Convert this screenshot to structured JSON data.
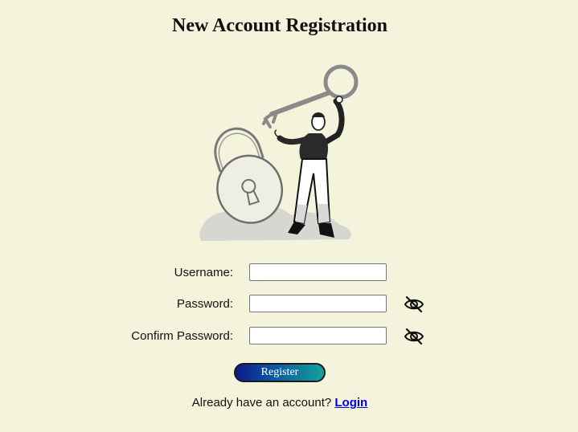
{
  "page": {
    "title": "New Account Registration"
  },
  "illustration": {
    "icon": "person-holding-key-with-padlock-illustration"
  },
  "form": {
    "username_label": "Username:",
    "username_value": "",
    "password_label": "Password:",
    "password_value": "",
    "confirm_label": "Confirm Password:",
    "confirm_value": "",
    "toggle_icon": "eye-slash-icon",
    "register_label": "Register"
  },
  "footer": {
    "prompt": "Already have an account?",
    "login_link": "Login"
  },
  "colors": {
    "background": "#f4f4dc",
    "button_gradient_start": "#0a1a8c",
    "button_gradient_end": "#12a39a",
    "link": "#0000ee"
  }
}
